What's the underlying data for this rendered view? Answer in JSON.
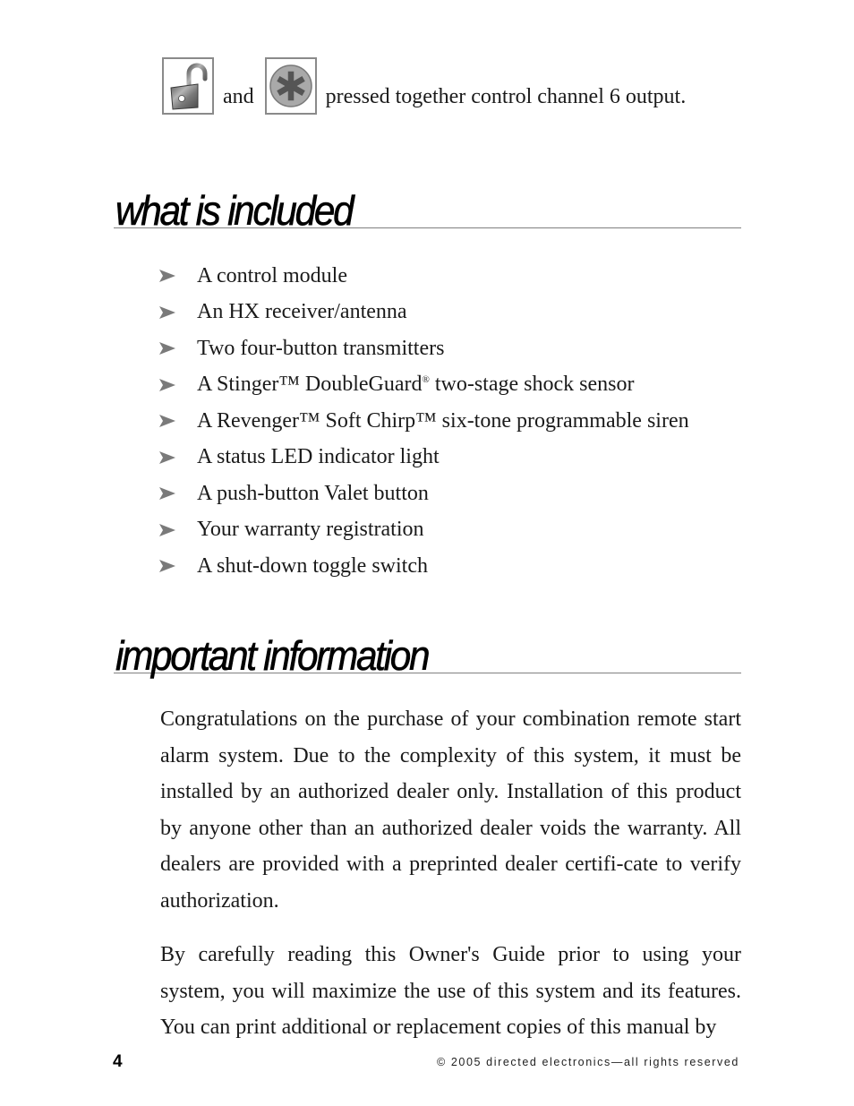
{
  "intro": {
    "icon_1": "unlock-button-icon",
    "and_text": "and",
    "icon_2": "asterisk-button-icon",
    "rest_text": "pressed together control channel 6 output."
  },
  "sections": {
    "included": {
      "title": "what is included",
      "items": [
        "A control module",
        "An HX receiver/antenna",
        "Two four-button transmitters",
        {
          "before": "A Stinger™ DoubleGuard",
          "sup": "®",
          "after": " two-stage shock sensor"
        },
        "A Revenger™ Soft Chirp™ six-tone programmable siren",
        "A status LED indicator light",
        "A push-button Valet button",
        "Your warranty registration",
        "A shut-down toggle switch"
      ]
    },
    "important": {
      "title": "important information",
      "paragraphs": [
        "Congratulations on the purchase of your combination remote start alarm system. Due to the complexity of this system, it must be installed by an authorized dealer only. Installation of this product by anyone other than an authorized dealer voids the warranty. All dealers are provided with a preprinted dealer certifi-cate to verify authorization.",
        "By carefully reading this Owner's Guide prior to using your system, you will maximize the use of this system and its features. You can print additional or replacement copies of this manual by"
      ]
    }
  },
  "footer": {
    "page_number": "4",
    "copyright": "© 2005 directed electronics—all rights reserved"
  },
  "colors": {
    "bullet": "#7a7a7a",
    "rule": "#808080",
    "icon_border": "#8a8a8a",
    "asterisk_disc": "#a9a9a9",
    "asterisk": "#555555"
  }
}
